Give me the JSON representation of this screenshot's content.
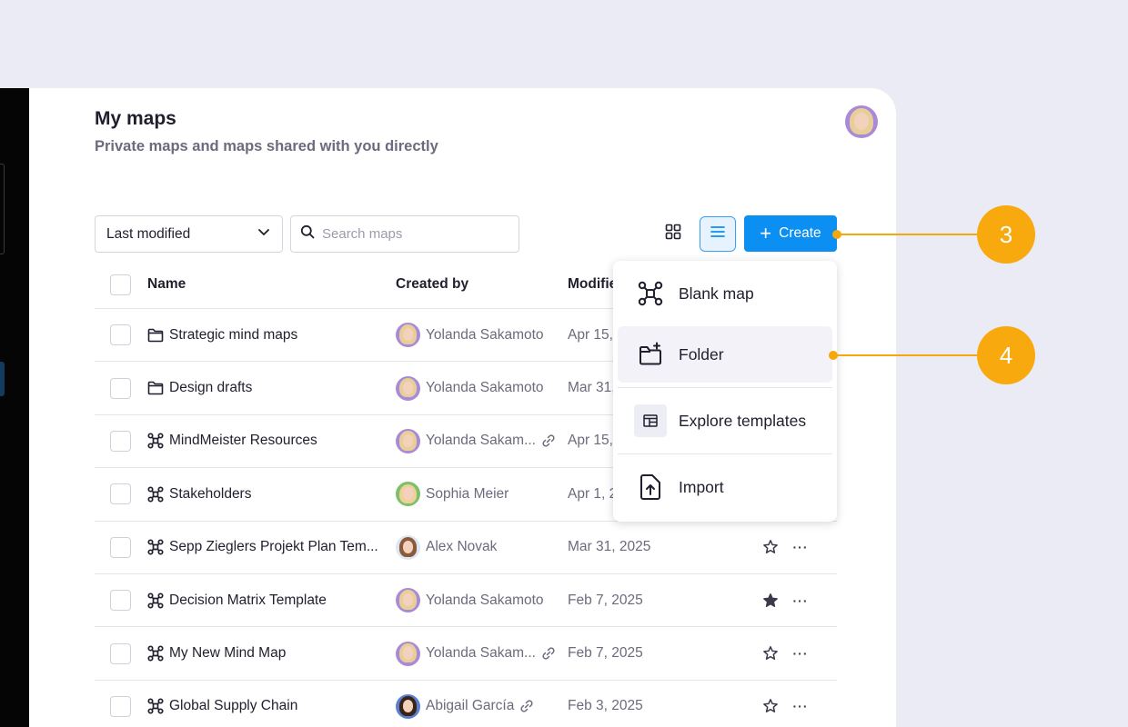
{
  "page": {
    "title": "My maps",
    "subtitle": "Private maps and maps shared with you directly"
  },
  "toolbar": {
    "sort_label": "Last modified",
    "search_placeholder": "Search maps",
    "create_label": "Create",
    "view_mode": "list"
  },
  "table": {
    "columns": [
      "Name",
      "Created by",
      "Modified"
    ],
    "rows": [
      {
        "type": "folder",
        "name": "Strategic mind maps",
        "created_by": "Yolanda Sakamoto",
        "modified": "Apr 15,",
        "shared_link": false,
        "starred": null
      },
      {
        "type": "folder",
        "name": "Design drafts",
        "created_by": "Yolanda Sakamoto",
        "modified": "Mar 31,",
        "shared_link": false,
        "starred": null
      },
      {
        "type": "map",
        "name": "MindMeister Resources",
        "created_by": "Yolanda Sakam...",
        "modified": "Apr 15,",
        "shared_link": true,
        "starred": null
      },
      {
        "type": "map",
        "name": "Stakeholders",
        "created_by": "Sophia Meier",
        "modified": "Apr 1, 2",
        "shared_link": false,
        "starred": null
      },
      {
        "type": "map",
        "name": "Sepp Zieglers Projekt Plan Tem...",
        "created_by": "Alex Novak",
        "modified": "Mar 31, 2025",
        "shared_link": false,
        "starred": false
      },
      {
        "type": "map",
        "name": "Decision Matrix Template",
        "created_by": "Yolanda Sakamoto",
        "modified": "Feb 7, 2025",
        "shared_link": false,
        "starred": true
      },
      {
        "type": "map",
        "name": "My New Mind Map",
        "created_by": "Yolanda Sakam...",
        "modified": "Feb 7, 2025",
        "shared_link": true,
        "starred": false
      },
      {
        "type": "map",
        "name": "Global Supply Chain",
        "created_by": "Abigail García",
        "modified": "Feb 3, 2025",
        "shared_link": true,
        "starred": false
      }
    ]
  },
  "create_menu": {
    "items": [
      {
        "label": "Blank map",
        "icon": "mindmap-icon"
      },
      {
        "label": "Folder",
        "icon": "new-folder-icon"
      },
      {
        "label": "Explore templates",
        "icon": "template-icon"
      },
      {
        "label": "Import",
        "icon": "import-icon"
      }
    ],
    "highlighted": "Folder"
  },
  "callouts": {
    "create": "3",
    "folder": "4"
  },
  "colors": {
    "accent": "#0b8ff2",
    "callout": "#f8a90d",
    "background": "#ebebf5"
  }
}
